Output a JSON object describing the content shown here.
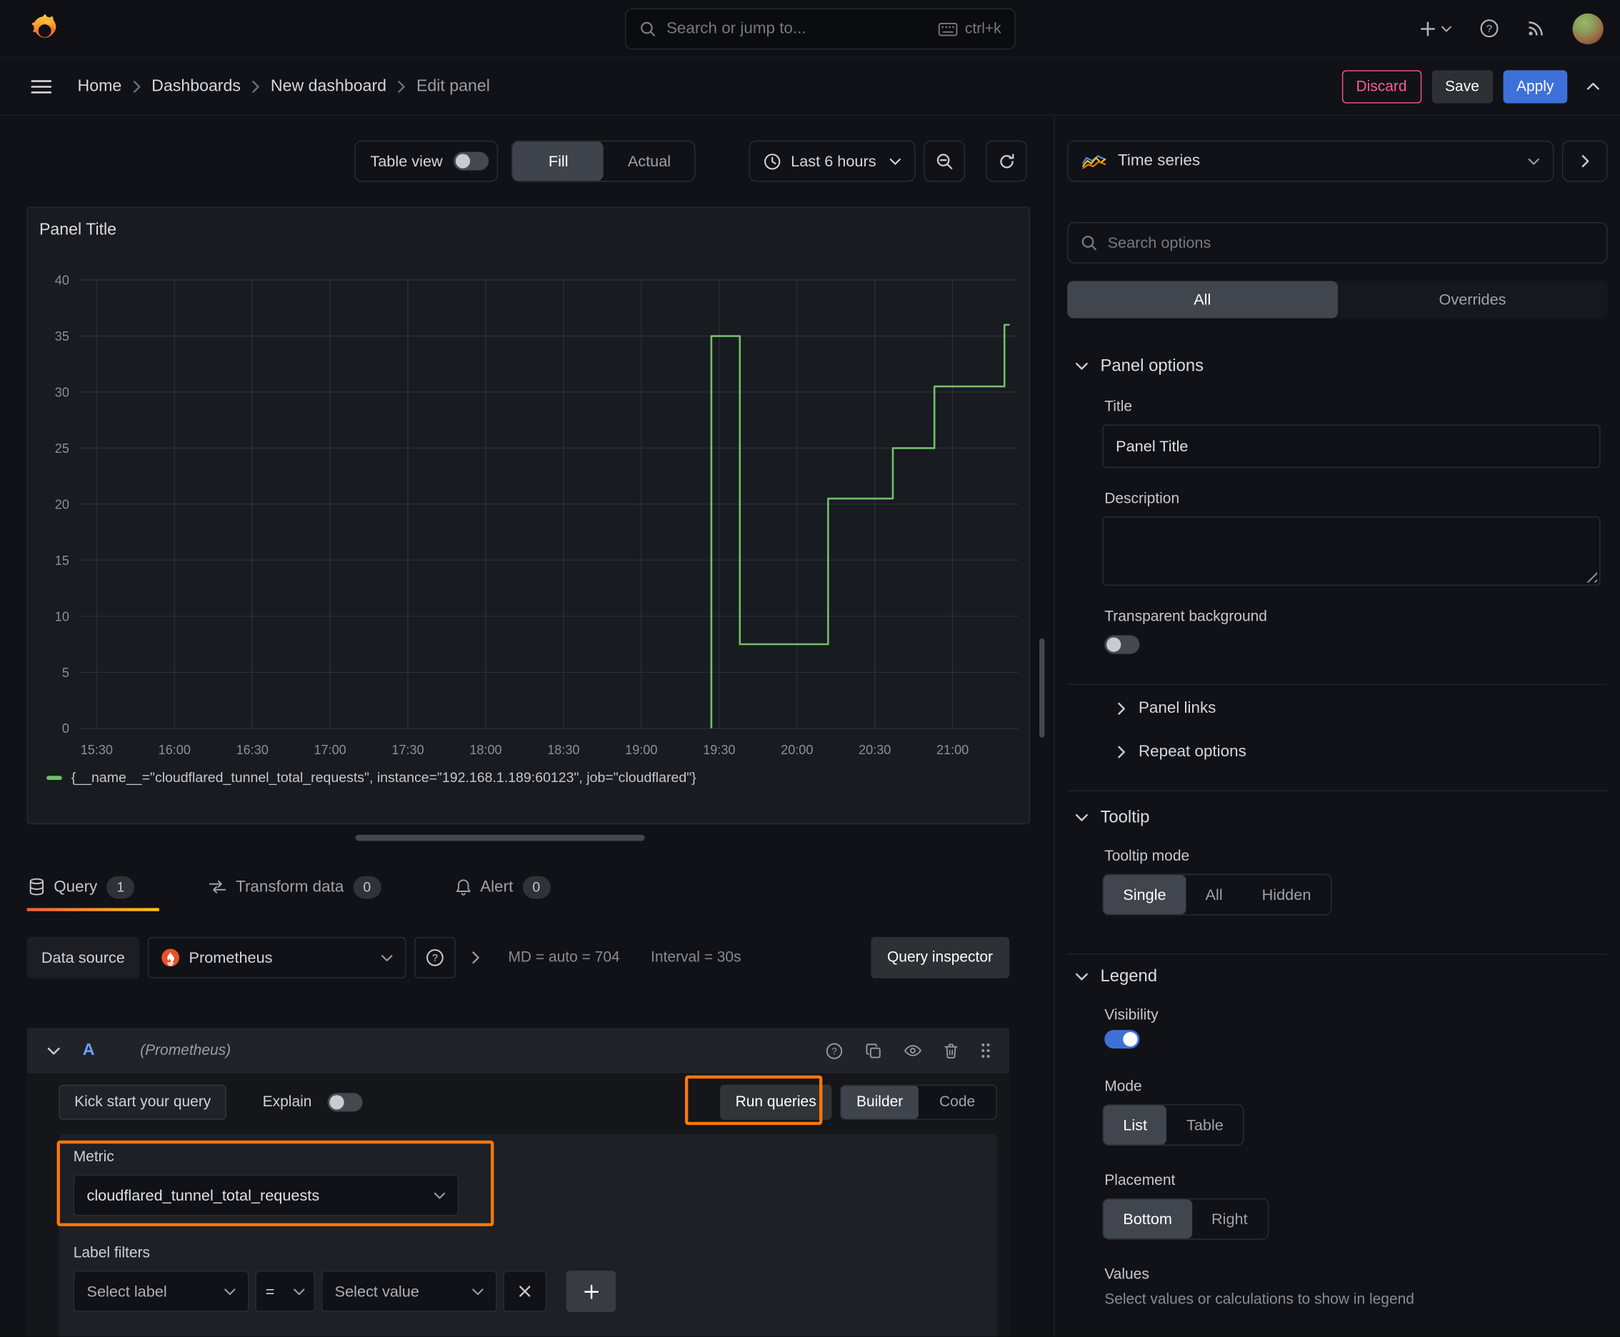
{
  "icons": {
    "question_mark": "?"
  },
  "topnav": {
    "search_placeholder": "Search or jump to...",
    "search_shortcut": "ctrl+k"
  },
  "breadcrumbs": {
    "items": [
      "Home",
      "Dashboards",
      "New dashboard",
      "Edit panel"
    ]
  },
  "actions": {
    "discard": "Discard",
    "save": "Save",
    "apply": "Apply"
  },
  "panel_toolbar": {
    "table_view": "Table view",
    "fill": "Fill",
    "actual": "Actual",
    "time_range": "Last 6 hours"
  },
  "viz_picker": {
    "label": "Time series"
  },
  "panel": {
    "title": "Panel Title"
  },
  "chart_data": {
    "type": "line",
    "title": "Panel Title",
    "series": [
      {
        "name": "{__name__=\"cloudflared_tunnel_total_requests\", instance=\"192.168.1.189:60123\", job=\"cloudflared\"}",
        "color": "#73bf69"
      }
    ],
    "x_unit": "minutes_after_midnight",
    "x_domain_minutes": [
      923,
      1285.5
    ],
    "x_tick_start_minute": 930,
    "x_tick_step_minute": 30,
    "x_ticks": [
      "15:30",
      "16:00",
      "16:30",
      "17:00",
      "17:30",
      "18:00",
      "18:30",
      "19:00",
      "19:30",
      "20:00",
      "20:30",
      "21:00"
    ],
    "y_ticks": [
      0,
      5,
      10,
      15,
      20,
      25,
      30,
      35,
      40
    ],
    "ylim": [
      0,
      40
    ],
    "grid": true,
    "legend_position": "bottom",
    "points": [
      [
        1167,
        0
      ],
      [
        1167,
        35
      ],
      [
        1178,
        35
      ],
      [
        1178,
        7.5
      ],
      [
        1212,
        7.5
      ],
      [
        1212,
        20.5
      ],
      [
        1237,
        20.5
      ],
      [
        1237,
        25
      ],
      [
        1253,
        25
      ],
      [
        1253,
        30.5
      ],
      [
        1280,
        30.5
      ],
      [
        1280,
        36
      ],
      [
        1282,
        36
      ]
    ]
  },
  "tabs": {
    "query": {
      "label": "Query",
      "count": "1"
    },
    "transform": {
      "label": "Transform data",
      "count": "0"
    },
    "alert": {
      "label": "Alert",
      "count": "0"
    }
  },
  "query_editor": {
    "datasource_label": "Data source",
    "datasource": "Prometheus",
    "stats_md": "MD = auto = 704",
    "stats_interval": "Interval = 30s",
    "query_inspector": "Query inspector",
    "ref_id": "A",
    "ds_hint": "(Prometheus)",
    "kickstart": "Kick start your query",
    "explain": "Explain",
    "run_queries": "Run queries",
    "builder": "Builder",
    "code": "Code",
    "metric_label": "Metric",
    "metric_value": "cloudflared_tunnel_total_requests",
    "label_filters": "Label filters",
    "select_label": "Select label",
    "operator": "=",
    "select_value": "Select value"
  },
  "options_sidebar": {
    "search_placeholder": "Search options",
    "tab_all": "All",
    "tab_overrides": "Overrides",
    "panel_options": {
      "title": "Panel options",
      "title_label": "Title",
      "title_value": "Panel Title",
      "description_label": "Description",
      "transparent_label": "Transparent background",
      "panel_links": "Panel links",
      "repeat_options": "Repeat options"
    },
    "tooltip": {
      "title": "Tooltip",
      "mode_label": "Tooltip mode",
      "options": [
        "Single",
        "All",
        "Hidden"
      ],
      "selected": "Single"
    },
    "legend": {
      "title": "Legend",
      "visibility_label": "Visibility",
      "mode_label": "Mode",
      "mode_options": [
        "List",
        "Table"
      ],
      "mode_selected": "List",
      "placement_label": "Placement",
      "placement_options": [
        "Bottom",
        "Right"
      ],
      "placement_selected": "Bottom",
      "values_label": "Values",
      "values_hint": "Select values or calculations to show in legend"
    }
  }
}
